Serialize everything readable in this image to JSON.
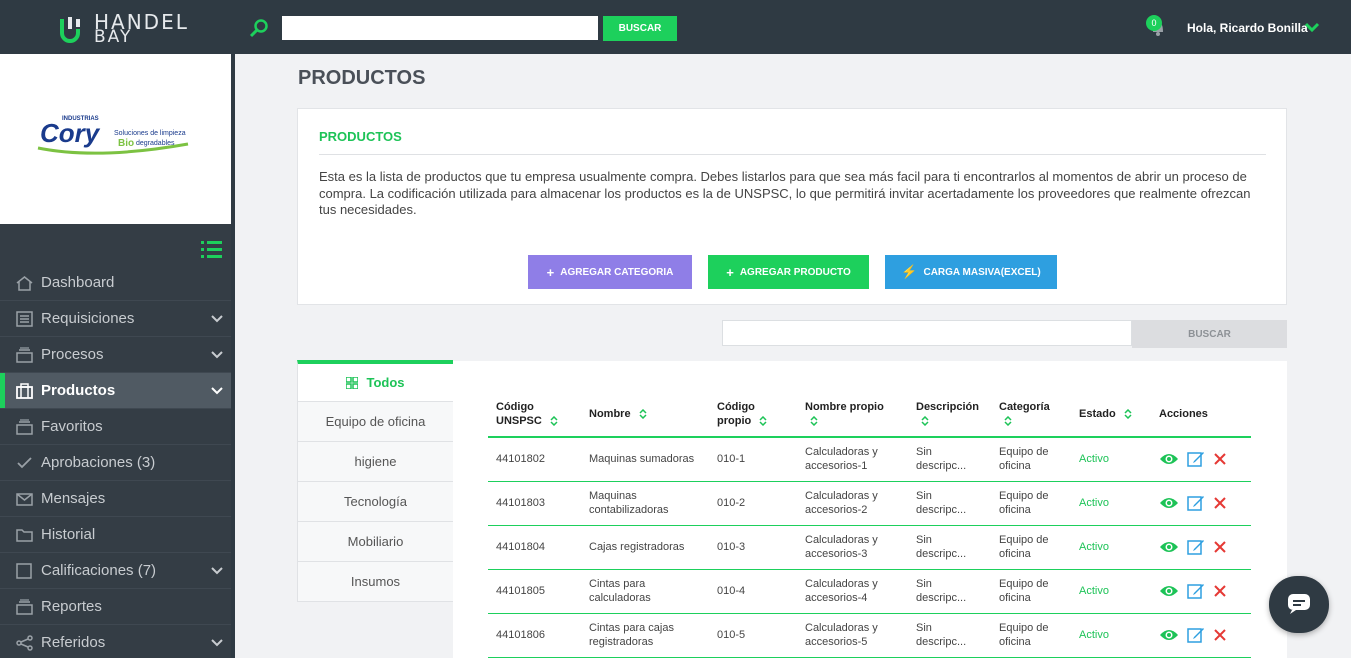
{
  "topbar": {
    "brand_line1": "HANDEL",
    "brand_line2": "BAY",
    "search_placeholder": "",
    "search_button": "BUSCAR",
    "notification_count": "0",
    "greeting": "Hola, Ricardo Bonilla"
  },
  "company_logo": {
    "top_word": "INDUSTRIAS",
    "name": "Cory",
    "tagline1": "Soluciones de limpieza",
    "tagline2_bio": "Bio",
    "tagline2_rest": "degradables"
  },
  "sidebar": {
    "items": [
      {
        "label": "Dashboard",
        "icon": "home-icon",
        "chevron": false,
        "active": false
      },
      {
        "label": "Requisiciones",
        "icon": "list-icon",
        "chevron": true,
        "active": false
      },
      {
        "label": "Procesos",
        "icon": "stack-icon",
        "chevron": true,
        "active": false
      },
      {
        "label": "Productos",
        "icon": "briefcase-icon",
        "chevron": true,
        "active": true
      },
      {
        "label": "Favoritos",
        "icon": "stack-icon",
        "chevron": false,
        "active": false
      },
      {
        "label": "Aprobaciones (3)",
        "icon": "check-icon",
        "chevron": false,
        "active": false
      },
      {
        "label": "Mensajes",
        "icon": "mail-icon",
        "chevron": false,
        "active": false
      },
      {
        "label": "Historial",
        "icon": "folder-icon",
        "chevron": false,
        "active": false
      },
      {
        "label": "Calificaciones (7)",
        "icon": "square-icon",
        "chevron": true,
        "active": false
      },
      {
        "label": "Reportes",
        "icon": "stack-icon",
        "chevron": false,
        "active": false
      },
      {
        "label": "Referidos",
        "icon": "share-icon",
        "chevron": true,
        "active": false
      }
    ]
  },
  "main": {
    "page_title": "PRODUCTOS",
    "card_title": "PRODUCTOS",
    "description": "Esta es la lista de productos que tu empresa usualmente compra. Debes listarlos para que sea más facil para ti encontrarlos al momentos de abrir un proceso de compra. La codificación utilizada para almacenar los productos es la de UNSPSC, lo que permitirá invitar acertadamente los proveedores que realmente ofrezcan tus necesidades.",
    "btn_category": "AGREGAR CATEGORIA",
    "btn_product": "AGREGAR PRODUCTO",
    "btn_excel": "CARGA MASIVA(EXCEL)",
    "search_button": "BUSCAR"
  },
  "categories": [
    "Todos",
    "Equipo de oficina",
    "higiene",
    "Tecnología",
    "Mobiliario",
    "Insumos"
  ],
  "table": {
    "headers": [
      "Código UNSPSC",
      "Nombre",
      "Código propio",
      "Nombre propio",
      "Descripción",
      "Categoría",
      "Estado",
      "Acciones"
    ],
    "rows": [
      {
        "code": "44101802",
        "name": "Maquinas sumadoras",
        "own_code": "010-1",
        "own_name": "Calculadoras y accesorios-1",
        "desc": "Sin descripc...",
        "cat": "Equipo de oficina",
        "status": "Activo"
      },
      {
        "code": "44101803",
        "name": "Maquinas contabilizadoras",
        "own_code": "010-2",
        "own_name": "Calculadoras y accesorios-2",
        "desc": "Sin descripc...",
        "cat": "Equipo de oficina",
        "status": "Activo"
      },
      {
        "code": "44101804",
        "name": "Cajas registradoras",
        "own_code": "010-3",
        "own_name": "Calculadoras y accesorios-3",
        "desc": "Sin descripc...",
        "cat": "Equipo de oficina",
        "status": "Activo"
      },
      {
        "code": "44101805",
        "name": "Cintas para calculadoras",
        "own_code": "010-4",
        "own_name": "Calculadoras y accesorios-4",
        "desc": "Sin descripc...",
        "cat": "Equipo de oficina",
        "status": "Activo"
      },
      {
        "code": "44101806",
        "name": "Cintas para cajas registradoras",
        "own_code": "010-5",
        "own_name": "Calculadoras y accesorios-5",
        "desc": "Sin descripc...",
        "cat": "Equipo de oficina",
        "status": "Activo"
      }
    ]
  },
  "colors": {
    "accent_green": "#1dd05c",
    "topbar": "#2f3a43",
    "sidebar": "#343d45",
    "purple": "#8f7ee7",
    "blue": "#2e9fe0",
    "danger": "#e53935"
  }
}
